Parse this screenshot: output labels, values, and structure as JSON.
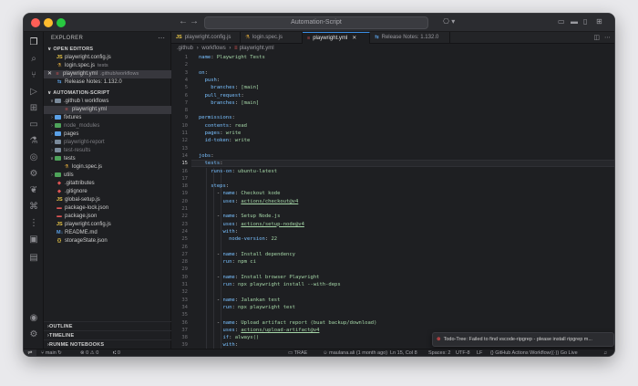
{
  "window": {
    "title": "Automation-Script"
  },
  "sidebar": {
    "header": "EXPLORER",
    "open_editors_label": "OPEN EDITORS",
    "open_editors": [
      {
        "icon": "JS",
        "name": "playwright.config.js",
        "dim": ""
      },
      {
        "icon": "⚗",
        "name": "login.spec.js",
        "dim": "tests"
      },
      {
        "icon": "≡",
        "name": "playwright.yml",
        "dim": ".github/workflows"
      },
      {
        "icon": "⇆",
        "name": "Release Notes: 1.132.0",
        "dim": ""
      }
    ],
    "project_label": "AUTOMATION-SCRIPT",
    "tree": [
      {
        "label": ".github \\ workflows",
        "kind": "folder"
      },
      {
        "label": "playwright.yml",
        "kind": "file"
      },
      {
        "label": "fixtures",
        "kind": "folder"
      },
      {
        "label": "node_modules",
        "kind": "folder"
      },
      {
        "label": "pages",
        "kind": "folder"
      },
      {
        "label": "playwright-report",
        "kind": "folder"
      },
      {
        "label": "test-results",
        "kind": "folder"
      },
      {
        "label": "tests",
        "kind": "folder"
      },
      {
        "label": "login.spec.js",
        "kind": "file"
      },
      {
        "label": "utils",
        "kind": "folder"
      },
      {
        "label": ".gitattributes",
        "kind": "file"
      },
      {
        "label": ".gitignore",
        "kind": "file"
      },
      {
        "label": "global-setup.js",
        "kind": "file"
      },
      {
        "label": "package-lock.json",
        "kind": "file"
      },
      {
        "label": "package.json",
        "kind": "file"
      },
      {
        "label": "playwright.config.js",
        "kind": "file"
      },
      {
        "label": "README.md",
        "kind": "file"
      },
      {
        "label": "storageState.json",
        "kind": "file"
      }
    ],
    "bottom_sections": [
      "OUTLINE",
      "TIMELINE",
      "RUNME NOTEBOOKS"
    ]
  },
  "tabs": [
    {
      "icon": "JS",
      "label": "playwright.config.js"
    },
    {
      "icon": "⚗",
      "label": "login.spec.js"
    },
    {
      "icon": "≡",
      "label": "playwright.yml"
    },
    {
      "icon": "⇆",
      "label": "Release Notes: 1.132.0"
    }
  ],
  "breadcrumb": [
    ".github",
    "workflows",
    "playwright.yml"
  ],
  "code": [
    "name: Playwright Tests",
    "",
    "on:",
    "  push:",
    "    branches: [main]",
    "  pull_request:",
    "    branches: [main]",
    "",
    "permissions:",
    "  contents: read",
    "  pages: write",
    "  id-token: write",
    "",
    "jobs:",
    "  tests:",
    "    runs-on: ubuntu-latest",
    "",
    "    steps:",
    "      - name: Checkout kode",
    "        uses: actions/checkout@v4",
    "",
    "      - name: Setup Node.js",
    "        uses: actions/setup-node@v4",
    "        with:",
    "          node-version: 22",
    "",
    "      - name: Install dependency",
    "        run: npm ci",
    "",
    "      - name: Install browser Playwright",
    "        run: npx playwright install --with-deps",
    "",
    "      - name: Jalankan test",
    "        run: npx playwright test",
    "",
    "      - name: Upload artifact report (buat backup/download)",
    "        uses: actions/upload-artifact@v4",
    "        if: always()",
    "        with:",
    "          name: playwright-report",
    "          path: playwright-report/"
  ],
  "current_line": 15,
  "notification": {
    "text": "Todo-Tree: Failed to find vscode-ripgrep - please install ripgrep m..."
  },
  "status": {
    "branch": "main",
    "sync": "↻",
    "errors": "0",
    "warnings": "0",
    "ports": "0",
    "trae": "TRAE",
    "blame": "maulana.ali (1 month ago)",
    "position": "Ln 15, Col 8",
    "spaces": "Spaces: 2",
    "encoding": "UTF-8",
    "eol": "LF",
    "language": "GitHub Actions Workflow",
    "golive": "Go Live"
  }
}
